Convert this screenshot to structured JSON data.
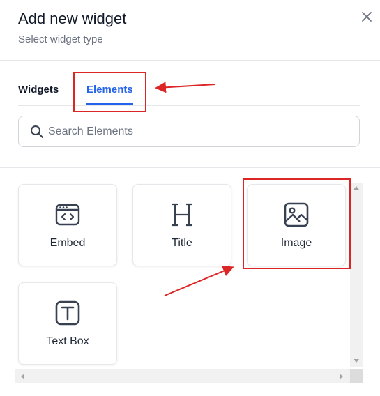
{
  "dialog": {
    "title": "Add new widget",
    "subtitle": "Select widget type",
    "close_icon": "close-icon"
  },
  "tabs": [
    {
      "label": "Widgets",
      "active": false
    },
    {
      "label": "Elements",
      "active": true
    }
  ],
  "search": {
    "placeholder": "Search Elements",
    "value": ""
  },
  "elements": [
    {
      "label": "Embed",
      "icon": "embed-icon"
    },
    {
      "label": "Title",
      "icon": "heading-icon"
    },
    {
      "label": "Image",
      "icon": "image-icon"
    },
    {
      "label": "Text Box",
      "icon": "text-box-icon"
    }
  ],
  "colors": {
    "accent": "#2563eb",
    "highlight": "#dc2626",
    "icon": "#374151"
  }
}
